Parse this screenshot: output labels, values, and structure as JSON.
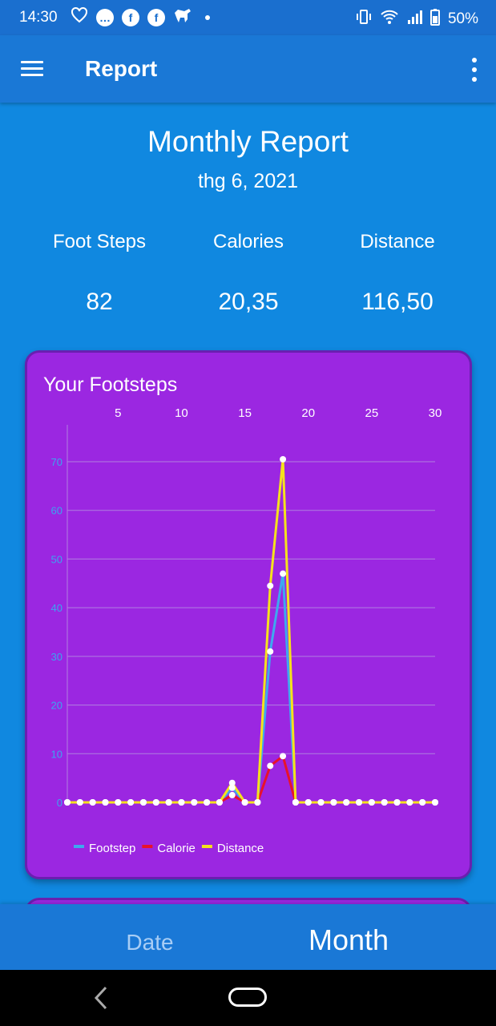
{
  "status_bar": {
    "time": "14:30",
    "battery": "50%",
    "left_icons": [
      "heart-outline-icon",
      "messenger-icon",
      "facebook-icon",
      "facebook-icon",
      "dog-icon",
      "dot-icon"
    ],
    "right_icons": [
      "vibrate-icon",
      "wifi-icon",
      "signal-icon",
      "battery-icon"
    ]
  },
  "appbar": {
    "title": "Report"
  },
  "header": {
    "title": "Monthly Report",
    "date": "thg 6, 2021"
  },
  "stats": [
    {
      "label": "Foot Steps",
      "value": "82"
    },
    {
      "label": "Calories",
      "value": "20,35"
    },
    {
      "label": "Distance",
      "value": "116,50"
    }
  ],
  "card": {
    "title": "Your Footsteps"
  },
  "chart_data": {
    "type": "line",
    "title": "",
    "x_ticks": [
      "5",
      "10",
      "15",
      "20",
      "25",
      "30"
    ],
    "y_ticks": [
      "0",
      "10",
      "20",
      "30",
      "40",
      "50",
      "60",
      "70"
    ],
    "ylim": [
      0,
      70
    ],
    "xlim": [
      1,
      30
    ],
    "x_axis_position": "top",
    "x": [
      1,
      2,
      3,
      4,
      5,
      6,
      7,
      8,
      9,
      10,
      11,
      12,
      13,
      14,
      15,
      16,
      17,
      18,
      19,
      20,
      21,
      22,
      23,
      24,
      25,
      26,
      27,
      28,
      29,
      30
    ],
    "series": [
      {
        "name": "Footstep",
        "color": "#3ea8ef",
        "values": [
          0,
          0,
          0,
          0,
          0,
          0,
          0,
          0,
          0,
          0,
          0,
          0,
          0,
          3,
          0,
          0,
          31,
          47,
          0,
          0,
          0,
          0,
          0,
          0,
          0,
          0,
          0,
          0,
          0,
          0
        ]
      },
      {
        "name": "Calorie",
        "color": "#e8132a",
        "values": [
          0,
          0,
          0,
          0,
          0,
          0,
          0,
          0,
          0,
          0,
          0,
          0,
          0,
          1.5,
          0,
          0,
          7.5,
          9.5,
          0,
          0,
          0,
          0,
          0,
          0,
          0,
          0,
          0,
          0,
          0,
          0
        ]
      },
      {
        "name": "Distance",
        "color": "#f5e21c",
        "values": [
          0,
          0,
          0,
          0,
          0,
          0,
          0,
          0,
          0,
          0,
          0,
          0,
          0,
          4,
          0,
          0,
          44.5,
          70.5,
          0,
          0,
          0,
          0,
          0,
          0,
          0,
          0,
          0,
          0,
          0,
          0
        ]
      }
    ],
    "grid": true,
    "legend": "bottom-left"
  },
  "tabs": [
    {
      "label": "Date",
      "active": false
    },
    {
      "label": "Month",
      "active": true
    }
  ]
}
